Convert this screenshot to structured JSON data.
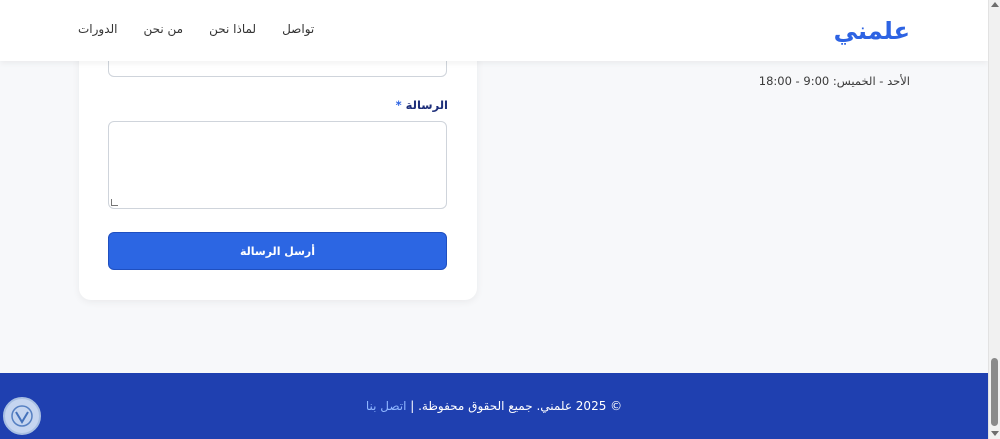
{
  "header": {
    "logo": "علمني",
    "nav": [
      {
        "label": "الدورات"
      },
      {
        "label": "من نحن"
      },
      {
        "label": "لماذا نحن"
      },
      {
        "label": "تواصل"
      }
    ]
  },
  "contact_info": {
    "hours": "الأحد - الخميس: 9:00 - 18:00"
  },
  "form": {
    "message_label": "الرسالة",
    "required_mark": "*",
    "submit_label": "أرسل الرسالة"
  },
  "footer": {
    "copyright": "© 2025 علمني. جميع الحقوق محفوظة. |",
    "contact_link": "اتصل بنا"
  },
  "colors": {
    "brand": "#2d63e3",
    "footer_bg": "#1f40b0",
    "button": "#2c66e3"
  }
}
